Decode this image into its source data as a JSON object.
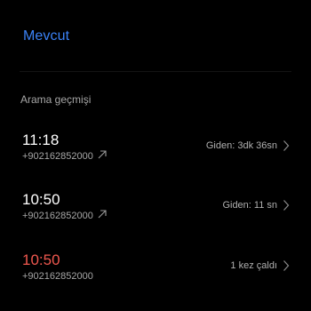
{
  "header": {
    "title": "Mevcut"
  },
  "section": {
    "title": "Arama geçmişi"
  },
  "calls": [
    {
      "time": "11:18",
      "number": "+902162852000",
      "status": "Giden: 3dk 36sn",
      "direction": "outgoing",
      "direction_icon": "outgoing-arrow-icon"
    },
    {
      "time": "10:50",
      "number": "+902162852000",
      "status": "Giden: 11 sn",
      "direction": "outgoing",
      "direction_icon": "outgoing-arrow-icon"
    },
    {
      "time": "10:50",
      "number": "+902162852000",
      "status": "1 kez çaldı",
      "direction": "missed"
    }
  ],
  "colors": {
    "accent": "#3b82f6",
    "missed": "#f0584f",
    "secondary_text": "#a6a6a6",
    "background": "#000000"
  }
}
